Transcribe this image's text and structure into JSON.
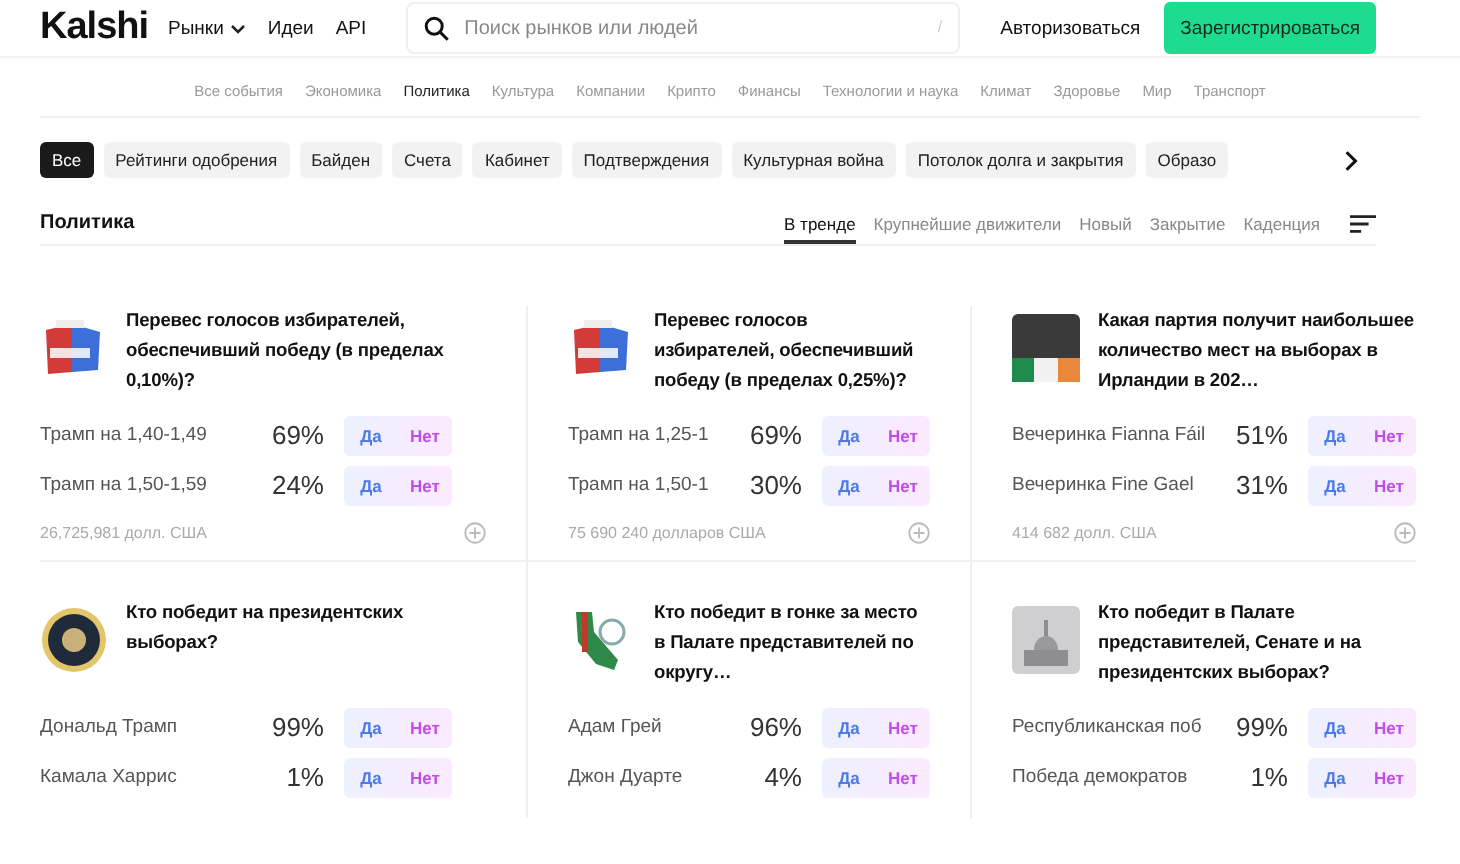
{
  "header": {
    "logo": "Kalshi",
    "nav": [
      {
        "label": "Рынки",
        "dropdown": true
      },
      {
        "label": "Идеи",
        "dropdown": false
      },
      {
        "label": "API",
        "dropdown": false
      }
    ],
    "search": {
      "placeholder": "Поиск рынков или людей",
      "shortcut": "/"
    },
    "login": "Авторизоваться",
    "signup": "Зарегистрироваться"
  },
  "categories": [
    {
      "label": "Все события",
      "selected": false
    },
    {
      "label": "Экономика",
      "selected": false
    },
    {
      "label": "Политика",
      "selected": true
    },
    {
      "label": "Культура",
      "selected": false
    },
    {
      "label": "Компании",
      "selected": false
    },
    {
      "label": "Крипто",
      "selected": false
    },
    {
      "label": "Финансы",
      "selected": false
    },
    {
      "label": "Технологии и наука",
      "selected": false
    },
    {
      "label": "Климат",
      "selected": false
    },
    {
      "label": "Здоровье",
      "selected": false
    },
    {
      "label": "Мир",
      "selected": false
    },
    {
      "label": "Транспорт",
      "selected": false
    }
  ],
  "chips": [
    {
      "label": "Все",
      "selected": true
    },
    {
      "label": "Рейтинги одобрения",
      "selected": false
    },
    {
      "label": "Байден",
      "selected": false
    },
    {
      "label": "Счета",
      "selected": false
    },
    {
      "label": "Кабинет",
      "selected": false
    },
    {
      "label": "Подтверждения",
      "selected": false
    },
    {
      "label": "Культурная война",
      "selected": false
    },
    {
      "label": "Потолок долга и закрытия",
      "selected": false
    },
    {
      "label": "Образо",
      "selected": false
    }
  ],
  "section": {
    "title": "Политика",
    "tabs": [
      {
        "label": "В тренде",
        "selected": true
      },
      {
        "label": "Крупнейшие движители",
        "selected": false
      },
      {
        "label": "Новый",
        "selected": false
      },
      {
        "label": "Закрытие",
        "selected": false
      },
      {
        "label": "Каденция",
        "selected": false
      }
    ]
  },
  "cards": [
    {
      "kind": "ballot",
      "title": "Перевес голосов избирателей, обеспечивший победу (в пределах 0,10%)?",
      "outcomes": [
        {
          "label": "Трамп на 1,40-1,49",
          "chance": "69%",
          "yes": "Да",
          "no": "Нет"
        },
        {
          "label": "Трамп на 1,50-1,59",
          "chance": "24%",
          "yes": "Да",
          "no": "Нет"
        }
      ],
      "volume": "26,725,981 долл. США"
    },
    {
      "kind": "ballot",
      "title": "Перевес голосов избирателей, обеспечивший победу (в пределах 0,25%)?",
      "outcomes": [
        {
          "label": "Трамп на 1,25-1",
          "chance": "69%",
          "yes": "Да",
          "no": "Нет"
        },
        {
          "label": "Трамп на 1,50-1",
          "chance": "30%",
          "yes": "Да",
          "no": "Нет"
        }
      ],
      "volume": "75 690 240 долларов США"
    },
    {
      "kind": "flag",
      "title": "Какая партия получит наибольшее количество мест на выборах в Ирландии в 202…",
      "outcomes": [
        {
          "label": "Вечеринка Fianna Fáil",
          "chance": "51%",
          "yes": "Да",
          "no": "Нет"
        },
        {
          "label": "Вечеринка Fine Gael",
          "chance": "31%",
          "yes": "Да",
          "no": "Нет"
        }
      ],
      "volume": "414 682 долл. США"
    },
    {
      "kind": "seal",
      "title": "Кто победит на президентских выборах?",
      "outcomes": [
        {
          "label": "Дональд Трамп",
          "chance": "99%",
          "yes": "Да",
          "no": "Нет"
        },
        {
          "label": "Камала Харрис",
          "chance": "1%",
          "yes": "Да",
          "no": "Нет"
        }
      ]
    },
    {
      "kind": "map",
      "title": "Кто победит в гонке за место в Палате представителей по округу…",
      "outcomes": [
        {
          "label": "Адам Грей",
          "chance": "96%",
          "yes": "Да",
          "no": "Нет"
        },
        {
          "label": "Джон Дуарте",
          "chance": "4%",
          "yes": "Да",
          "no": "Нет"
        }
      ]
    },
    {
      "kind": "capitol",
      "title": "Кто победит в Палате представителей, Сенате и на президентских выборах?",
      "outcomes": [
        {
          "label": "Республиканская поб",
          "chance": "99%",
          "yes": "Да",
          "no": "Нет"
        },
        {
          "label": "Победа демократов",
          "chance": "1%",
          "yes": "Да",
          "no": "Нет"
        }
      ]
    }
  ]
}
